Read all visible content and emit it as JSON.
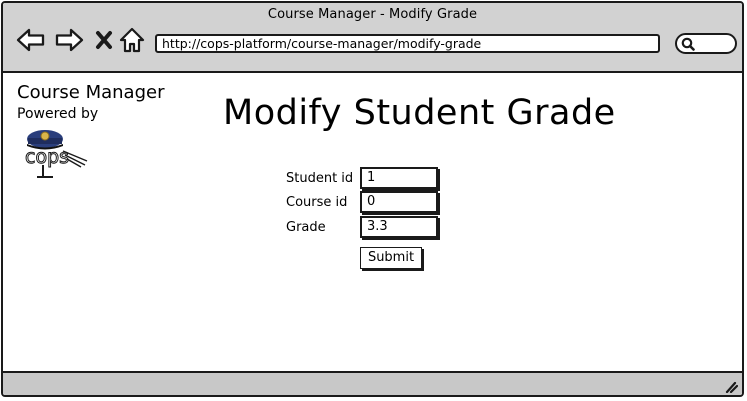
{
  "window": {
    "title": "Course Manager - Modify Grade"
  },
  "toolbar": {
    "back_icon": "back-arrow-icon",
    "forward_icon": "forward-arrow-icon",
    "stop_icon": "close-icon",
    "home_icon": "home-icon"
  },
  "address_bar": {
    "url": "http://cops-platform/course-manager/modify-grade"
  },
  "search": {
    "icon": "search-icon",
    "value": ""
  },
  "sidebar": {
    "app_name": "Course Manager",
    "powered_by": "Powered by",
    "logo_text": "cops",
    "logo_icon": "police-cap-icon"
  },
  "main": {
    "title": "Modify Student Grade",
    "form": {
      "fields": [
        {
          "label": "Student id",
          "value": "1"
        },
        {
          "label": "Course id",
          "value": "0"
        },
        {
          "label": "Grade",
          "value": "3.3"
        }
      ],
      "submit_label": "Submit"
    }
  },
  "colors": {
    "chrome_bg": "#d2d2d2",
    "border": "#1a1a1a",
    "logo_cap": "#2a3e7c"
  }
}
